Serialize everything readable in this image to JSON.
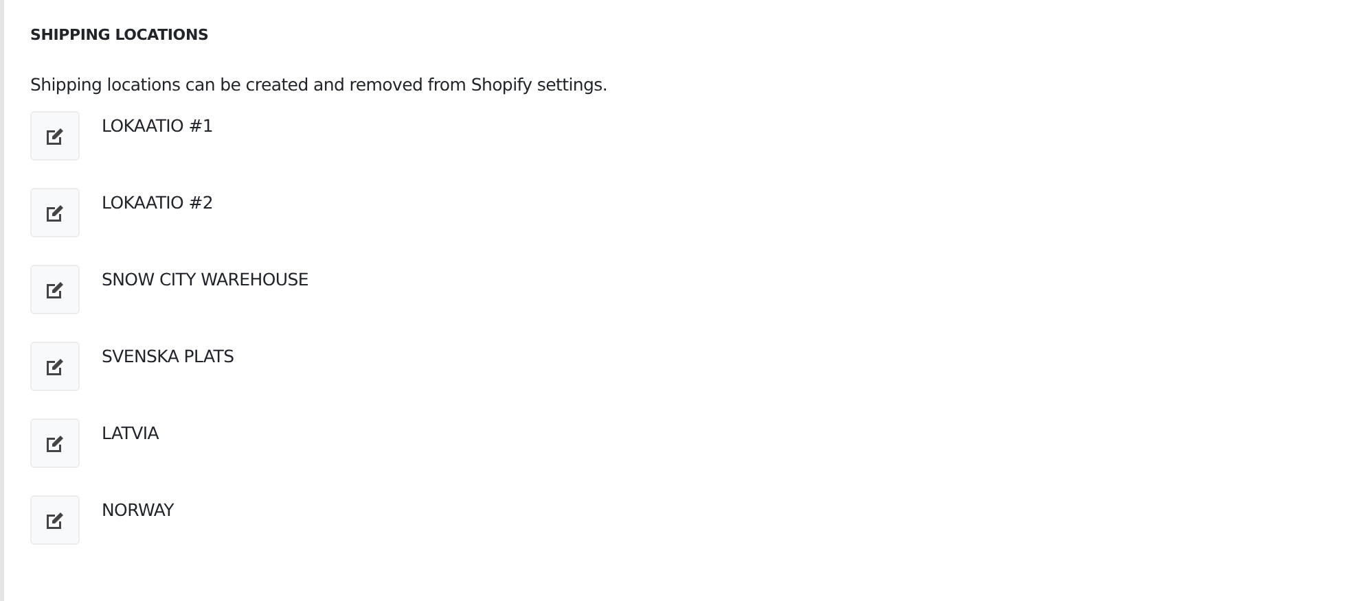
{
  "heading": "SHIPPING LOCATIONS",
  "description": "Shipping locations can be created and removed from Shopify settings.",
  "locations": [
    {
      "name": "LOKAATIO #1"
    },
    {
      "name": "LOKAATIO #2"
    },
    {
      "name": "SNOW CITY WAREHOUSE"
    },
    {
      "name": "SVENSKA PLATS"
    },
    {
      "name": "LATVIA"
    },
    {
      "name": "NORWAY"
    }
  ]
}
